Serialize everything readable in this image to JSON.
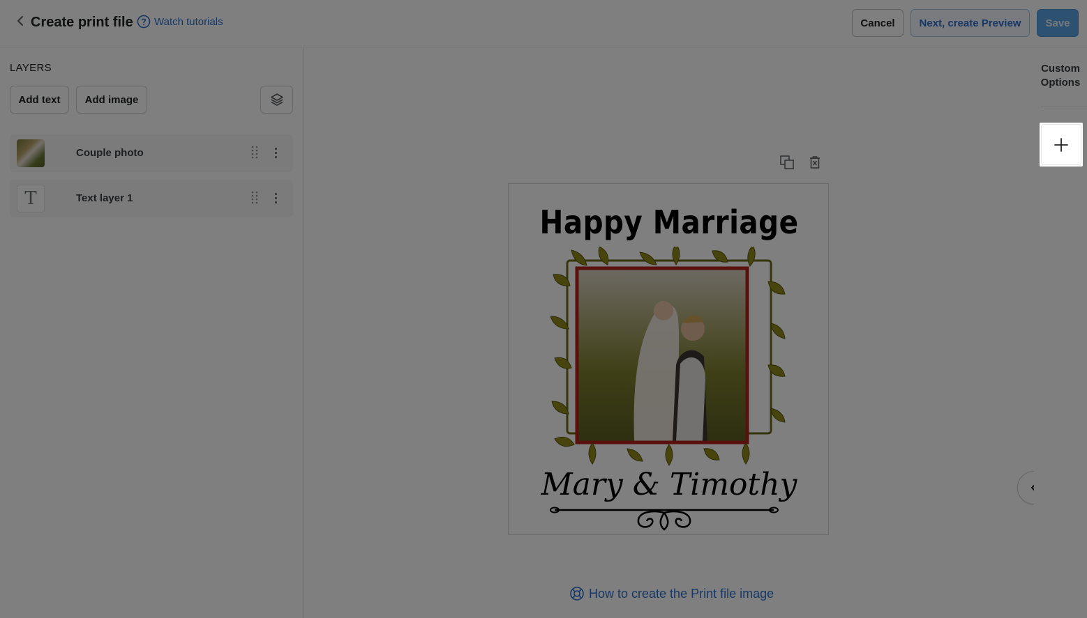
{
  "header": {
    "title": "Create print file",
    "tutorial_link": "Watch tutorials",
    "cancel_label": "Cancel",
    "next_label": "Next, create Preview",
    "save_label": "Save"
  },
  "sidebar": {
    "heading": "LAYERS",
    "add_text_label": "Add text",
    "add_image_label": "Add image",
    "layers": [
      {
        "name": "Couple photo",
        "type": "image"
      },
      {
        "name": "Text layer 1",
        "type": "text"
      }
    ]
  },
  "canvas": {
    "print_title": "Happy Marriage",
    "names": "Mary & Timothy",
    "help_link": "How to create the Print file image"
  },
  "right_rail": {
    "custom_options_line1": "Custom",
    "custom_options_line2": "Options",
    "add_option_icon": "plus-icon"
  },
  "colors": {
    "accent": "#2c6ecb",
    "save_button": "#5ba3e0",
    "overlay": "rgba(0,0,0,0.5)",
    "frame_red": "#b3221a",
    "leaf_olive": "#8f8a1a"
  }
}
